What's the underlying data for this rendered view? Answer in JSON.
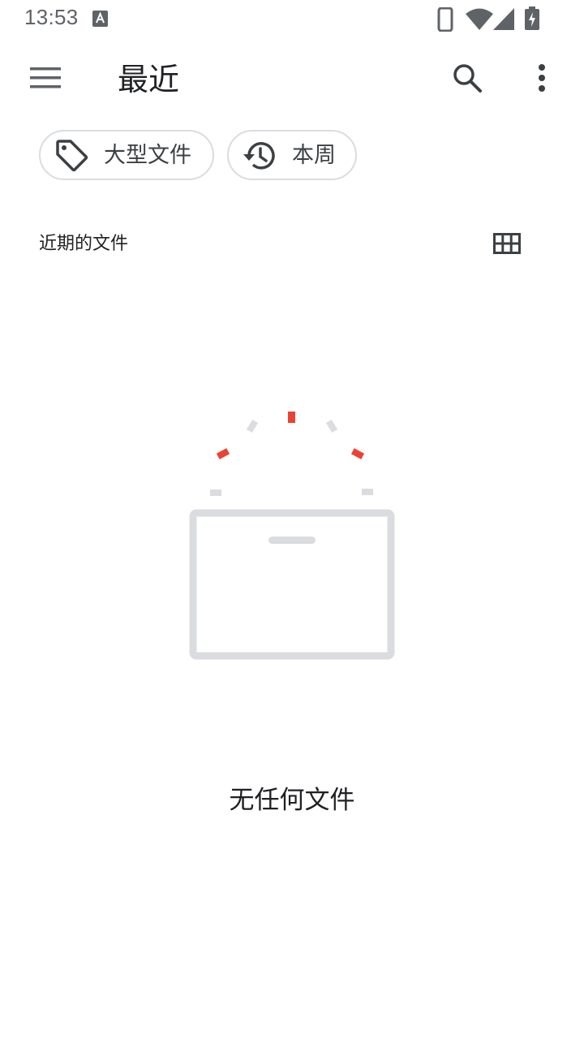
{
  "status_bar": {
    "time": "13:53",
    "icons": [
      "notification-a-icon",
      "phone-icon",
      "wifi-icon",
      "signal-icon",
      "battery-charging-icon"
    ]
  },
  "app_bar": {
    "title": "最近",
    "icons": [
      "menu-icon",
      "search-icon",
      "more-vert-icon"
    ]
  },
  "chips": [
    {
      "label": "大型文件",
      "icon": "tag-icon"
    },
    {
      "label": "本周",
      "icon": "history-icon"
    }
  ],
  "section": {
    "title": "近期的文件",
    "view_icon": "grid-view-icon"
  },
  "empty_state": {
    "message": "无任何文件",
    "icon": "empty-folder-icon"
  },
  "colors": {
    "text_primary": "#202124",
    "text_secondary": "#5f6368",
    "chip_border": "#dadce0",
    "illustration_gray": "#dadce0",
    "illustration_accent": "#ea4335"
  }
}
